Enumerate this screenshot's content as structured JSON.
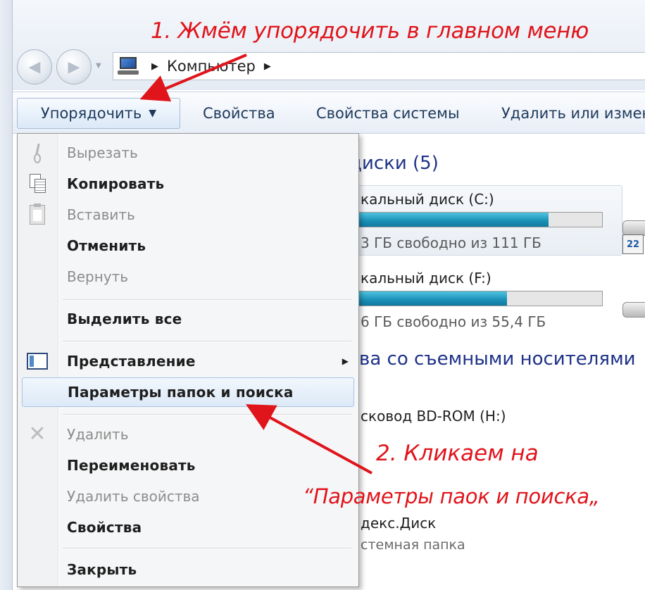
{
  "window": {
    "breadcrumb": "Компьютер"
  },
  "toolbar": {
    "organize_label": "Упорядочить",
    "properties_label": "Свойства",
    "system_properties_label": "Свойства системы",
    "uninstall_label": "Удалить или измен"
  },
  "content": {
    "hdd_group": "диски (5)",
    "drive_c": {
      "name": "кальный диск (C:)",
      "free_text": "3 ГБ свободно из 111 ГБ",
      "used_fraction": 0.78
    },
    "drive_f": {
      "name": "кальный диск (F:)",
      "free_text": "6 ГБ свободно из 55,4 ГБ",
      "used_fraction": 0.61
    },
    "removable_group": "ва со съемными носителями",
    "bd_drive": "сковод BD-ROM (H:)",
    "yandex_disk": "декс.Диск",
    "system_folder": "стемная папка"
  },
  "menu": {
    "cut": "Вырезать",
    "copy": "Копировать",
    "paste": "Вставить",
    "undo": "Отменить",
    "redo": "Вернуть",
    "select_all": "Выделить все",
    "layout": "Представление",
    "folder_options": "Параметры папок и поиска",
    "delete": "Удалить",
    "rename": "Переименовать",
    "remove_properties": "Удалить свойства",
    "properties": "Свойства",
    "close": "Закрыть"
  },
  "annotations": {
    "step1": "1. Жмём упорядочить в главном меню",
    "step2_line1": "2. Кликаем на",
    "step2_line2": "“Параметры паок и поиска„"
  },
  "colors": {
    "annotation_red": "#e0141b",
    "heading_blue": "#1e3287",
    "toolbar_text": "#1e395b",
    "bar_fill": "#1a8fb6"
  },
  "icons": {
    "nav_back": "back-arrow-icon",
    "nav_forward": "forward-arrow-icon",
    "address": "computer-icon",
    "cut": "scissors-icon",
    "copy": "copy-icon",
    "paste": "paste-icon",
    "layout": "layout-pane-icon",
    "delete": "delete-x-icon"
  }
}
